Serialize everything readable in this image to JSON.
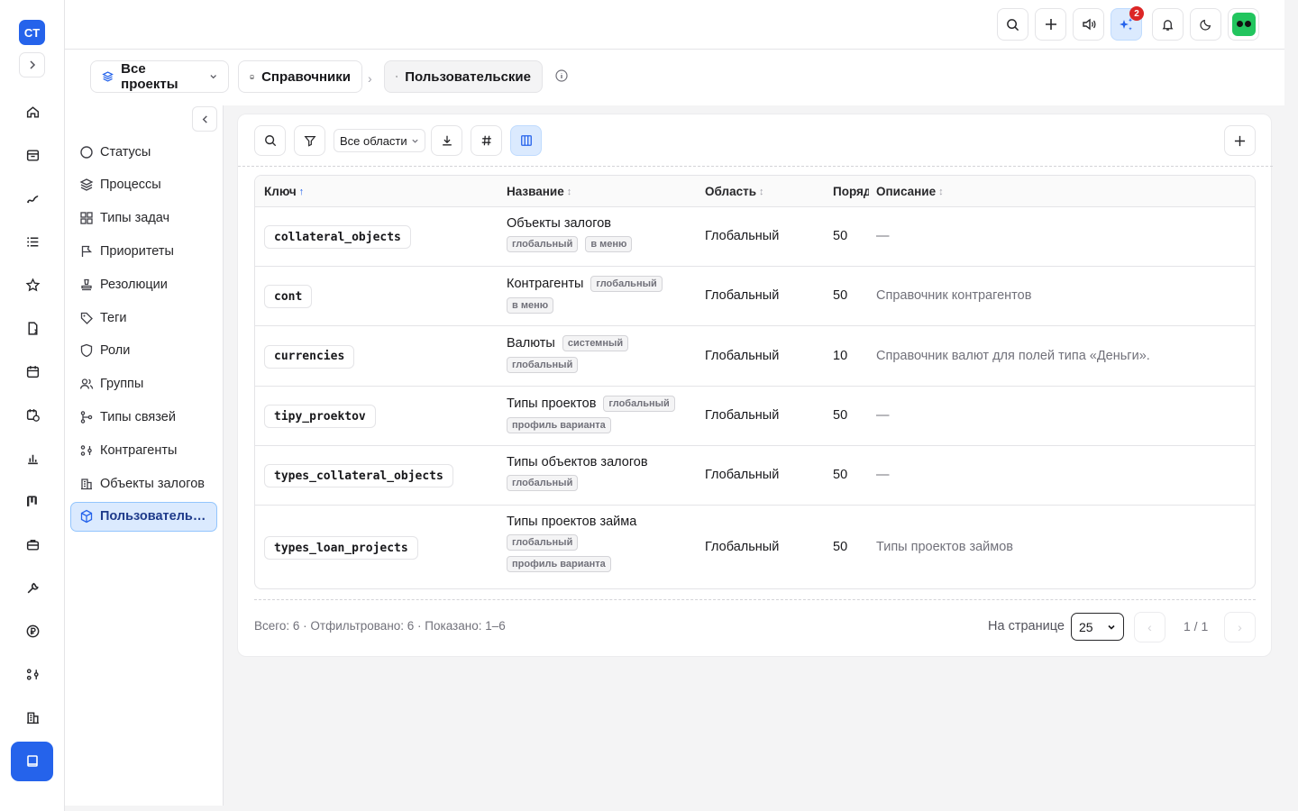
{
  "app": {
    "logo_text": "CT"
  },
  "rail": {
    "icons": [
      "home-icon",
      "inbox-icon",
      "route-icon",
      "list-icon",
      "star-icon",
      "document-icon",
      "calendar-icon",
      "calendar-clock-icon",
      "bar-chart-icon",
      "kanban-icon",
      "briefcase-icon",
      "wrench-icon",
      "ruble-icon",
      "nodes-icon",
      "building-icon",
      "book-icon"
    ]
  },
  "topbar": {
    "ai_badge_count": "2"
  },
  "breadcrumbs": [
    {
      "label": "Все проекты"
    },
    {
      "label": "Справочники"
    },
    {
      "label": "Пользовательские"
    }
  ],
  "sidebar": {
    "items": [
      {
        "label": "Статусы",
        "icon": "circle-icon"
      },
      {
        "label": "Процессы",
        "icon": "layers-icon"
      },
      {
        "label": "Типы задач",
        "icon": "grid-icon"
      },
      {
        "label": "Приоритеты",
        "icon": "flag-icon"
      },
      {
        "label": "Резолюции",
        "icon": "stamp-icon"
      },
      {
        "label": "Теги",
        "icon": "tag-icon"
      },
      {
        "label": "Роли",
        "icon": "shield-icon"
      },
      {
        "label": "Группы",
        "icon": "users-icon"
      },
      {
        "label": "Типы связей",
        "icon": "link-branch-icon"
      },
      {
        "label": "Контрагенты",
        "icon": "nodes-icon"
      },
      {
        "label": "Объекты залогов",
        "icon": "building-icon"
      },
      {
        "label": "Пользовательск...",
        "icon": "cube-icon",
        "active": true
      }
    ]
  },
  "toolbar": {
    "scope_select": "Все области"
  },
  "table": {
    "columns": [
      {
        "label": "Ключ",
        "sort": "asc"
      },
      {
        "label": "Название",
        "sort": "none"
      },
      {
        "label": "Область",
        "sort": "none"
      },
      {
        "label": "Поряд",
        "sort": "hidden"
      },
      {
        "label": "Описание",
        "sort": "none"
      }
    ],
    "rows": [
      {
        "key": "collateral_objects",
        "name": "Объекты залогов",
        "tags": [
          "глобальный",
          "в меню"
        ],
        "area": "Глобальный",
        "order": "50",
        "desc": "—"
      },
      {
        "key": "cont",
        "name": "Контрагенты",
        "tags": [
          "глобальный",
          "в меню"
        ],
        "area": "Глобальный",
        "order": "50",
        "desc": "Справочник контрагентов"
      },
      {
        "key": "currencies",
        "name": "Валюты",
        "tags": [
          "системный",
          "глобальный"
        ],
        "area": "Глобальный",
        "order": "10",
        "desc": "Справочник валют для полей типа «Деньги»."
      },
      {
        "key": "tipy_proektov",
        "name": "Типы проектов",
        "tags": [
          "глобальный",
          "профиль варианта"
        ],
        "area": "Глобальный",
        "order": "50",
        "desc": "—"
      },
      {
        "key": "types_collateral_objects",
        "name": "Типы объектов залогов",
        "tags": [
          "глобальный"
        ],
        "area": "Глобальный",
        "order": "50",
        "desc": "—"
      },
      {
        "key": "types_loan_projects",
        "name": "Типы проектов займа",
        "tags": [
          "глобальный",
          "профиль варианта"
        ],
        "area": "Глобальный",
        "order": "50",
        "desc": "Типы проектов займов"
      }
    ]
  },
  "footer": {
    "summary": "Всего: 6 · Отфильтровано: 6 · Показано: 1–6",
    "per_page_label": "На странице",
    "per_page_value": "25",
    "page_indicator": "1 / 1",
    "prev": "‹",
    "next": "›"
  }
}
